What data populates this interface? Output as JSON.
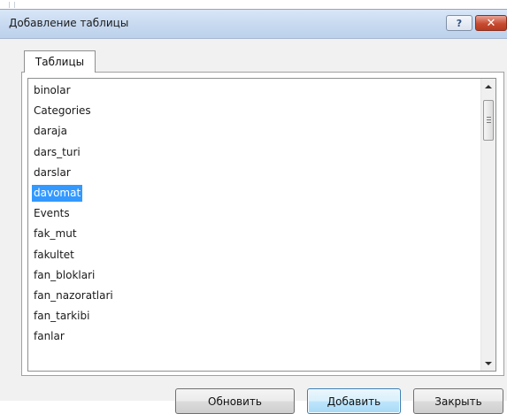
{
  "dialog": {
    "title": "Добавление таблицы",
    "help_label": "?",
    "close_label": "✕"
  },
  "tabs": [
    {
      "label": "Таблицы",
      "active": true
    }
  ],
  "table_list": {
    "items": [
      "binolar",
      "Categories",
      "daraja",
      "dars_turi",
      "darslar",
      "davomat",
      "Events",
      "fak_mut",
      "fakultet",
      "fan_bloklari",
      "fan_nazoratlari",
      "fan_tarkibi",
      "fanlar"
    ],
    "selected": "davomat",
    "selected_color": "#3399ff"
  },
  "buttons": {
    "refresh": "Обновить",
    "add": "Добавить",
    "close": "Закрыть"
  }
}
